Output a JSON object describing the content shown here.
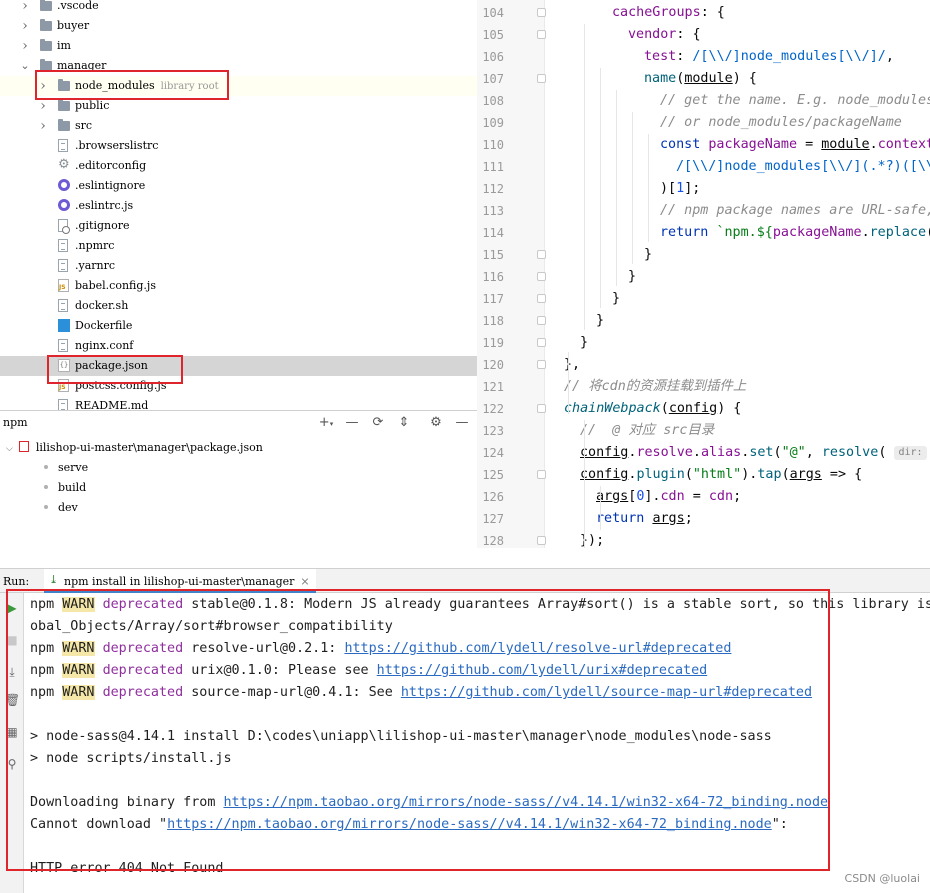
{
  "project_tree": {
    "items": [
      {
        "label": ".vscode",
        "type": "folder",
        "collapsed": true
      },
      {
        "label": "buyer",
        "type": "folder",
        "collapsed": true
      },
      {
        "label": "im",
        "type": "folder",
        "collapsed": true
      },
      {
        "label": "manager",
        "type": "folder",
        "collapsed": false
      },
      {
        "label": "node_modules",
        "hint": "library root",
        "type": "folder",
        "collapsed": true
      },
      {
        "label": "public",
        "type": "folder",
        "collapsed": true
      },
      {
        "label": "src",
        "type": "folder",
        "collapsed": true
      },
      {
        "label": ".browserslistrc",
        "type": "file"
      },
      {
        "label": ".editorconfig",
        "type": "gear"
      },
      {
        "label": ".eslintignore",
        "type": "eslint"
      },
      {
        "label": ".eslintrc.js",
        "type": "eslint"
      },
      {
        "label": ".gitignore",
        "type": "git"
      },
      {
        "label": ".npmrc",
        "type": "file"
      },
      {
        "label": ".yarnrc",
        "type": "file"
      },
      {
        "label": "babel.config.js",
        "type": "js"
      },
      {
        "label": "docker.sh",
        "type": "file"
      },
      {
        "label": "Dockerfile",
        "type": "docker"
      },
      {
        "label": "nginx.conf",
        "type": "file"
      },
      {
        "label": "package.json",
        "type": "json"
      },
      {
        "label": "postcss.config.js",
        "type": "js"
      },
      {
        "label": "README.md",
        "type": "file"
      }
    ]
  },
  "editor": {
    "line_numbers": [
      "104",
      "105",
      "106",
      "107",
      "108",
      "109",
      "110",
      "111",
      "112",
      "113",
      "114",
      "115",
      "116",
      "117",
      "118",
      "119",
      "120",
      "121",
      "122",
      "123",
      "124",
      "125",
      "126",
      "127",
      "128"
    ],
    "inlay_hint": "dir:"
  },
  "npm_panel": {
    "title": "npm",
    "tree_root": "lilishop-ui-master\\manager\\package.json",
    "scripts": [
      "serve",
      "build",
      "dev"
    ]
  },
  "run_bar": {
    "label": "Run:",
    "tab_label": "npm install in lilishop-ui-master\\manager",
    "close": "×"
  },
  "console": {
    "warn_tag": "WARN",
    "lines": [
      {
        "prefix": "npm ",
        "warn": true,
        "deprecated": "deprecated",
        "text": " stable@0.1.8: Modern JS already guarantees Array#sort() is a stable sort, so this library is"
      },
      {
        "text": "obal_Objects/Array/sort#browser_compatibility"
      },
      {
        "prefix": "npm ",
        "warn": true,
        "deprecated": "deprecated",
        "text": " resolve-url@0.2.1: ",
        "link": "https://github.com/lydell/resolve-url#deprecated"
      },
      {
        "prefix": "npm ",
        "warn": true,
        "deprecated": "deprecated",
        "text": " urix@0.1.0: Please see ",
        "link": "https://github.com/lydell/urix#deprecated"
      },
      {
        "prefix": "npm ",
        "warn": true,
        "deprecated": "deprecated",
        "text": " source-map-url@0.4.1: See ",
        "link": "https://github.com/lydell/source-map-url#deprecated"
      },
      {
        "text": ""
      },
      {
        "text": "> node-sass@4.14.1 install D:\\codes\\uniapp\\lilishop-ui-master\\manager\\node_modules\\node-sass"
      },
      {
        "text": "> node scripts/install.js"
      },
      {
        "text": ""
      },
      {
        "text": "Downloading binary from ",
        "link": "https://npm.taobao.org/mirrors/node-sass//v4.14.1/win32-x64-72_binding.node"
      },
      {
        "text": "Cannot download \"",
        "link": "https://npm.taobao.org/mirrors/node-sass//v4.14.1/win32-x64-72_binding.node",
        "suffix": "\":"
      },
      {
        "text": ""
      },
      {
        "text": "HTTP error 404 Not Found"
      }
    ]
  },
  "watermark": "CSDN @luolai"
}
